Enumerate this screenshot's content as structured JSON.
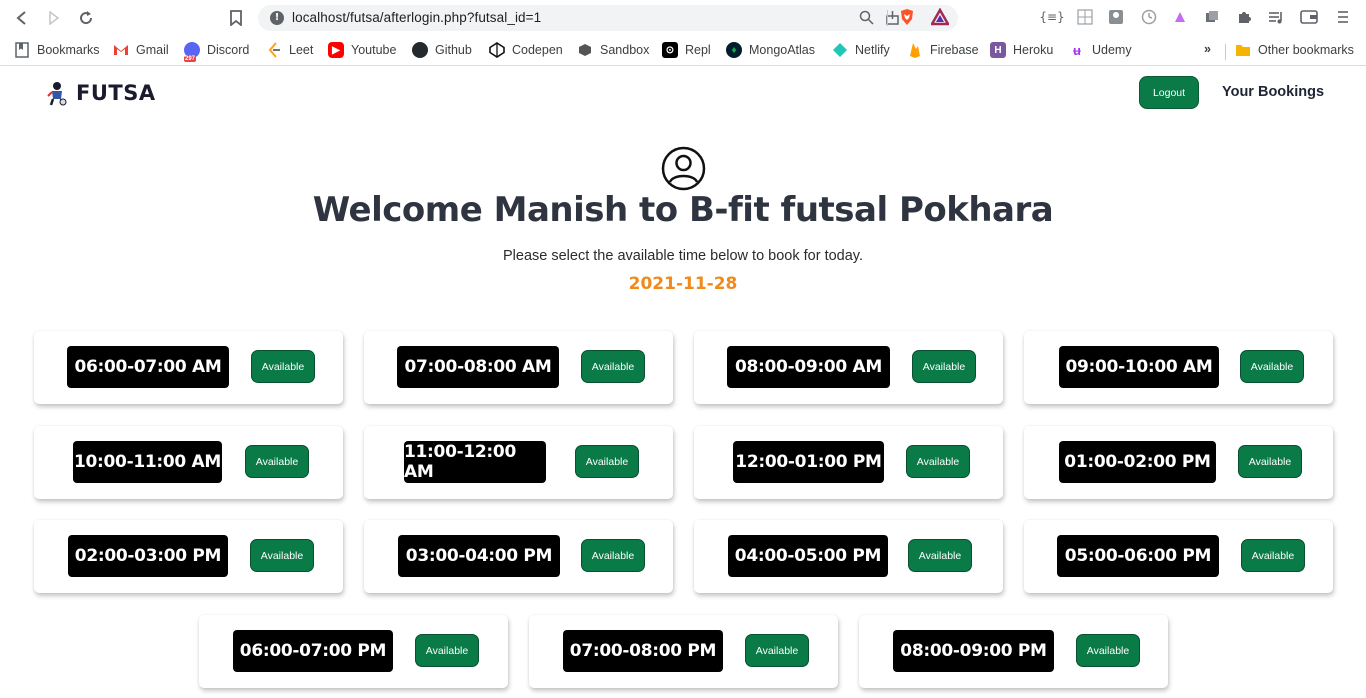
{
  "browser": {
    "url": "localhost/futsa/afterlogin.php?futsal_id=1",
    "bookmarks": [
      {
        "label": "Bookmarks",
        "icon": "bookmarks-icon"
      },
      {
        "label": "Gmail",
        "icon": "gmail-icon"
      },
      {
        "label": "Discord",
        "icon": "discord-icon",
        "badge": "297"
      },
      {
        "label": "Leet",
        "icon": "leetcode-icon"
      },
      {
        "label": "Youtube",
        "icon": "youtube-icon"
      },
      {
        "label": "Github",
        "icon": "github-icon"
      },
      {
        "label": "Codepen",
        "icon": "codepen-icon"
      },
      {
        "label": "Sandbox",
        "icon": "sandbox-icon"
      },
      {
        "label": "Repl",
        "icon": "repl-icon"
      },
      {
        "label": "MongoAtlas",
        "icon": "mongodb-icon"
      },
      {
        "label": "Netlify",
        "icon": "netlify-icon"
      },
      {
        "label": "Firebase",
        "icon": "firebase-icon"
      },
      {
        "label": "Heroku",
        "icon": "heroku-icon"
      },
      {
        "label": "Udemy",
        "icon": "udemy-icon"
      }
    ],
    "more_label": "»",
    "other_bookmarks": "Other bookmarks"
  },
  "header": {
    "brand": "FUTSA",
    "logout_label": "Logout",
    "bookings_label": "Your Bookings"
  },
  "main": {
    "welcome": "Welcome Manish to B-fit futsal Pokhara",
    "subtitle": "Please select the available time below to book for today.",
    "date": "2021-11-28"
  },
  "slots": [
    {
      "time": "06:00-07:00 AM",
      "status": "Available"
    },
    {
      "time": "07:00-08:00 AM",
      "status": "Available"
    },
    {
      "time": "08:00-09:00 AM",
      "status": "Available"
    },
    {
      "time": "09:00-10:00 AM",
      "status": "Available"
    },
    {
      "time": "10:00-11:00 AM",
      "status": "Available"
    },
    {
      "time": "11:00-12:00 AM",
      "status": "Available"
    },
    {
      "time": "12:00-01:00 PM",
      "status": "Available"
    },
    {
      "time": "01:00-02:00 PM",
      "status": "Available"
    },
    {
      "time": "02:00-03:00 PM",
      "status": "Available"
    },
    {
      "time": "03:00-04:00 PM",
      "status": "Available"
    },
    {
      "time": "04:00-05:00 PM",
      "status": "Available"
    },
    {
      "time": "05:00-06:00 PM",
      "status": "Available"
    },
    {
      "time": "06:00-07:00 PM",
      "status": "Available"
    },
    {
      "time": "07:00-08:00 PM",
      "status": "Available"
    },
    {
      "time": "08:00-09:00 PM",
      "status": "Available"
    }
  ],
  "colors": {
    "accent_green": "#0a7a47",
    "date_orange": "#f08a1c",
    "title_dark": "#2e3440"
  }
}
